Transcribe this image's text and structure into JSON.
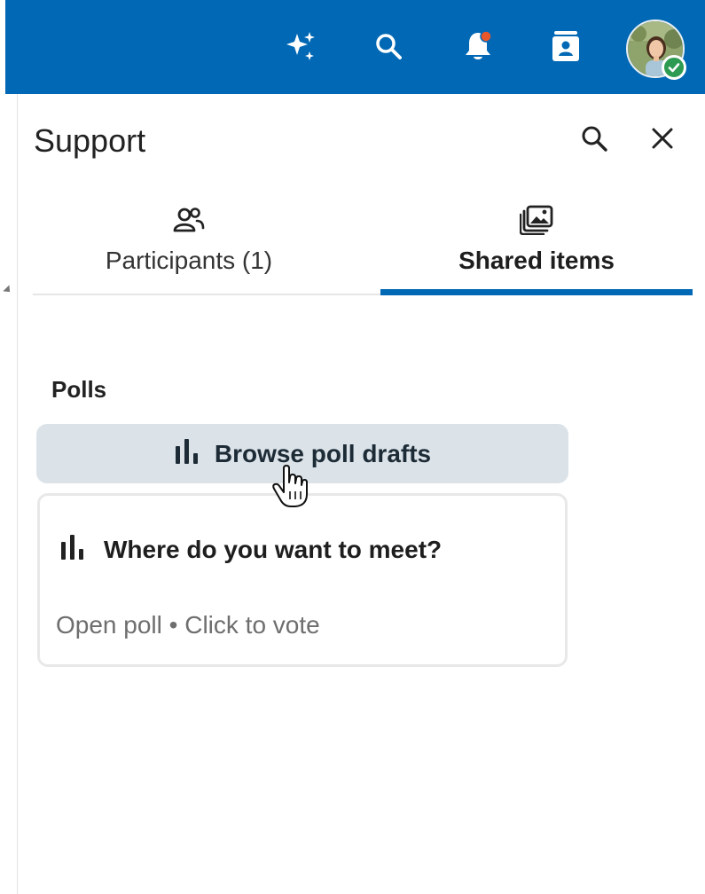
{
  "header": {
    "icons": [
      "sparkle-icon",
      "search-icon",
      "bell-icon",
      "contact-card-icon"
    ],
    "user": {
      "status": "available",
      "status_color": "#2e9b52"
    },
    "brand_color": "#0068b4"
  },
  "panel": {
    "title": "Support",
    "tabs": [
      {
        "label": "Participants (1)",
        "icon": "people-icon",
        "active": false
      },
      {
        "label": "Shared items",
        "icon": "media-stack-icon",
        "active": true
      }
    ],
    "polls": {
      "heading": "Polls",
      "browse_label": "Browse poll drafts",
      "items": [
        {
          "question": "Where do you want to meet?",
          "meta": "Open poll • Click to vote"
        }
      ]
    }
  }
}
